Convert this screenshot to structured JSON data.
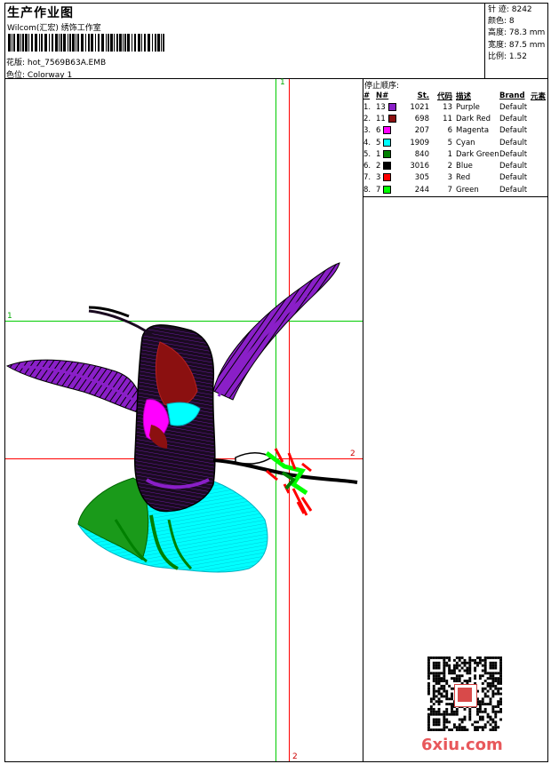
{
  "header": {
    "title": "生产作业图",
    "subtitle": "Wilcom(汇宏) 绣饰工作室",
    "design_label": "花版:",
    "design_file": "hot_7569B63A.EMB",
    "colorway_label": "色位:",
    "colorway": "Colorway 1"
  },
  "stats": {
    "stitches": "针 迹: 8242",
    "colors": "颜色: 8",
    "height": "高度: 78.3 mm",
    "width": "宽度: 87.5 mm",
    "scale": "比例: 1.52"
  },
  "stop_sequence": {
    "title": "停止顺序:",
    "headers": [
      "#",
      "N#",
      "St.",
      "代码",
      "描述",
      "Brand",
      "元素"
    ],
    "rows": [
      {
        "idx": "1.",
        "n": "13",
        "color": "#8a1fc8",
        "st": "1021",
        "code": "13",
        "desc": "Purple",
        "brand": "Default"
      },
      {
        "idx": "2.",
        "n": "11",
        "color": "#8b1010",
        "st": "698",
        "code": "11",
        "desc": "Dark Red",
        "brand": "Default"
      },
      {
        "idx": "3.",
        "n": "6",
        "color": "#ff00ff",
        "st": "207",
        "code": "6",
        "desc": "Magenta",
        "brand": "Default"
      },
      {
        "idx": "4.",
        "n": "5",
        "color": "#00ffff",
        "st": "1909",
        "code": "5",
        "desc": "Cyan",
        "brand": "Default"
      },
      {
        "idx": "5.",
        "n": "1",
        "color": "#008000",
        "st": "840",
        "code": "1",
        "desc": "Dark Green",
        "brand": "Default"
      },
      {
        "idx": "6.",
        "n": "2",
        "color": "#000000",
        "st": "3016",
        "code": "2",
        "desc": "Blue",
        "brand": "Default"
      },
      {
        "idx": "7.",
        "n": "3",
        "color": "#ff0000",
        "st": "305",
        "code": "3",
        "desc": "Red",
        "brand": "Default"
      },
      {
        "idx": "8.",
        "n": "7",
        "color": "#00ff00",
        "st": "244",
        "code": "7",
        "desc": "Green",
        "brand": "Default"
      }
    ]
  },
  "guides": {
    "green_label": "1",
    "red_label": "2"
  },
  "watermark": "6xiu.com"
}
